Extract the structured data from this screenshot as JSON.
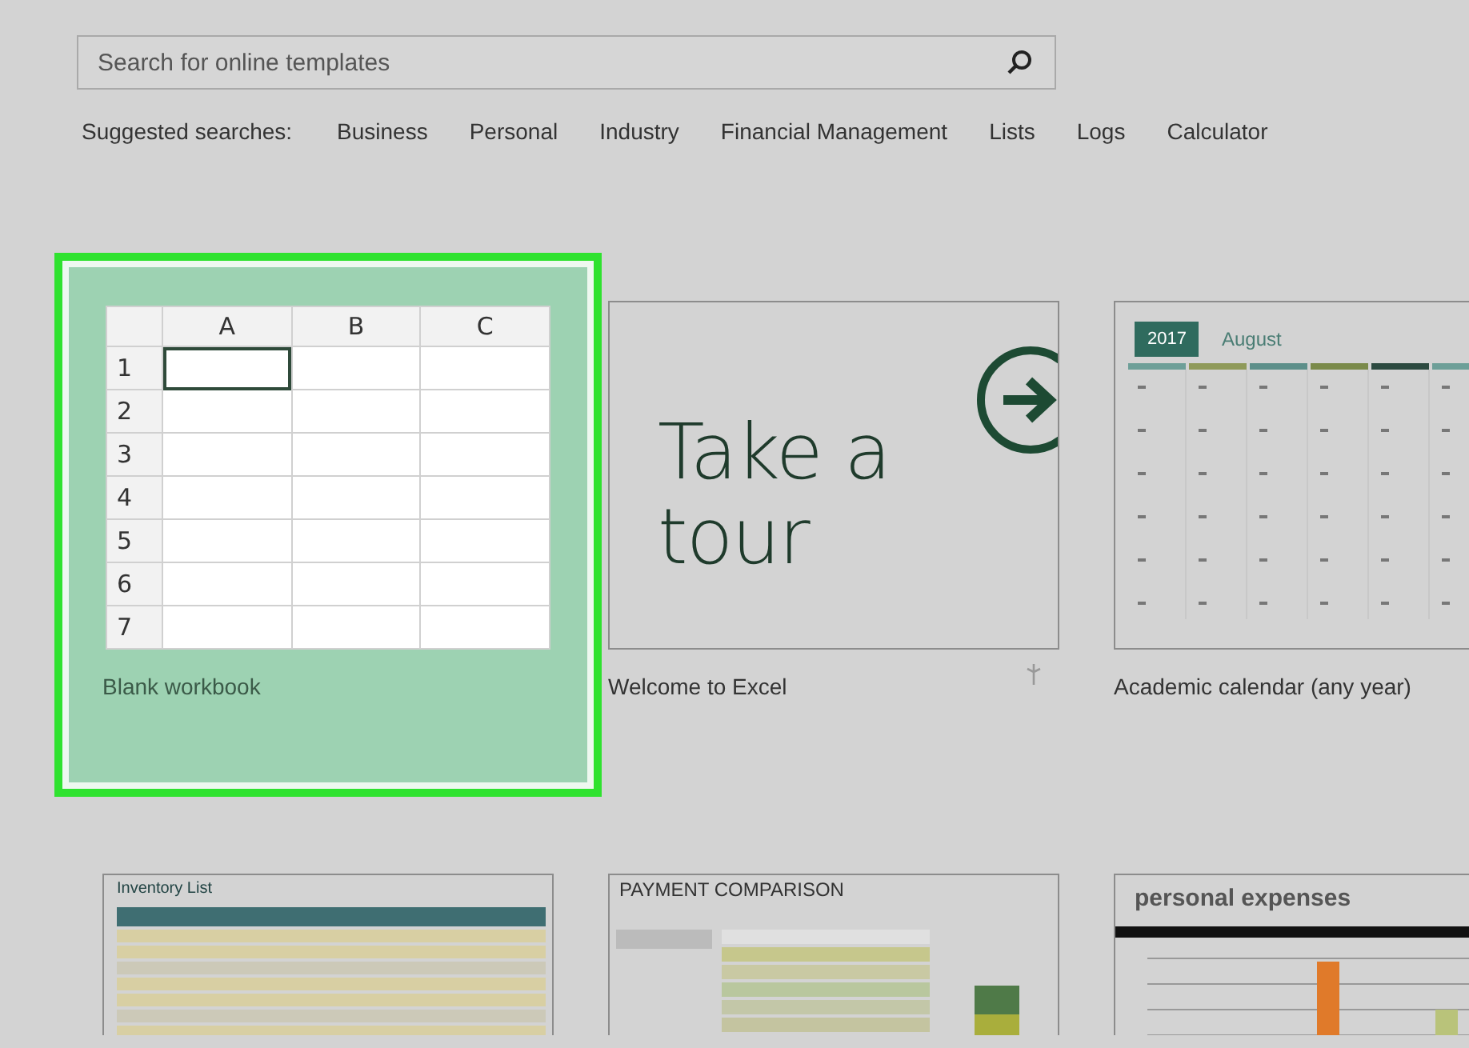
{
  "search": {
    "placeholder": "Search for online templates"
  },
  "suggested": {
    "label": "Suggested searches:",
    "items": [
      "Business",
      "Personal",
      "Industry",
      "Financial Management",
      "Lists",
      "Logs",
      "Calculator"
    ]
  },
  "templates": [
    {
      "kind": "blank",
      "label": "Blank workbook",
      "selected": true,
      "columns": [
        "A",
        "B",
        "C"
      ],
      "rows": [
        "1",
        "2",
        "3",
        "4",
        "5",
        "6",
        "7"
      ]
    },
    {
      "kind": "tour",
      "label": "Welcome to Excel",
      "selected": false,
      "heading": "Take a tour"
    },
    {
      "kind": "calendar",
      "label": "Academic calendar (any year)",
      "selected": false,
      "year": "2017",
      "month": "August"
    },
    {
      "kind": "inventory",
      "selected": false,
      "title": "Inventory List"
    },
    {
      "kind": "payment",
      "selected": false,
      "title": "PAYMENT COMPARISON"
    },
    {
      "kind": "expenses",
      "selected": false,
      "title": "personal expenses"
    }
  ]
}
